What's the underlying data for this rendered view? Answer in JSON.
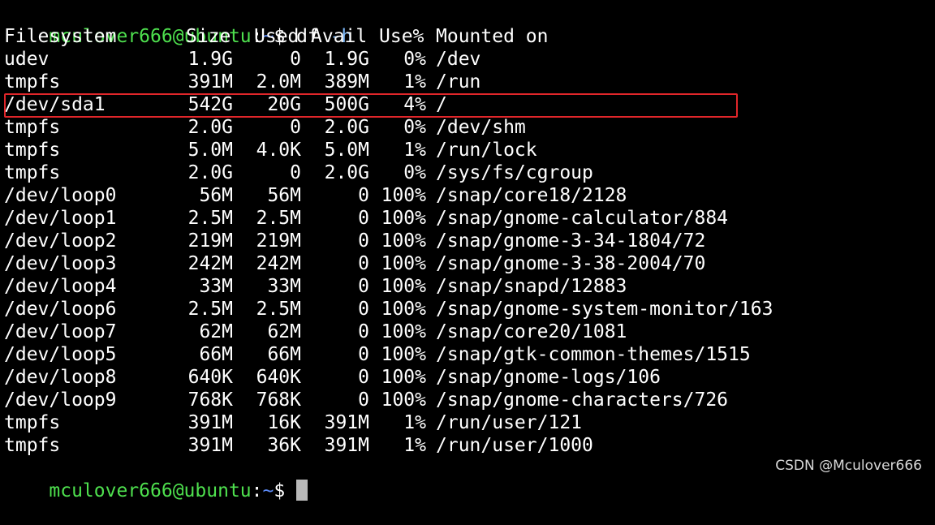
{
  "prompt": {
    "user_host": "mculover666@ubuntu",
    "separator": ":",
    "path": "~",
    "symbol": "$"
  },
  "command": {
    "name": "df",
    "flag": "-h"
  },
  "table": {
    "headers": [
      "Filesystem",
      "Size",
      "Used",
      "Avail",
      "Use%",
      "Mounted on"
    ],
    "rows": [
      [
        "udev",
        "1.9G",
        "0",
        "1.9G",
        "0%",
        "/dev"
      ],
      [
        "tmpfs",
        "391M",
        "2.0M",
        "389M",
        "1%",
        "/run"
      ],
      [
        "/dev/sda1",
        "542G",
        "20G",
        "500G",
        "4%",
        "/"
      ],
      [
        "tmpfs",
        "2.0G",
        "0",
        "2.0G",
        "0%",
        "/dev/shm"
      ],
      [
        "tmpfs",
        "5.0M",
        "4.0K",
        "5.0M",
        "1%",
        "/run/lock"
      ],
      [
        "tmpfs",
        "2.0G",
        "0",
        "2.0G",
        "0%",
        "/sys/fs/cgroup"
      ],
      [
        "/dev/loop0",
        "56M",
        "56M",
        "0",
        "100%",
        "/snap/core18/2128"
      ],
      [
        "/dev/loop1",
        "2.5M",
        "2.5M",
        "0",
        "100%",
        "/snap/gnome-calculator/884"
      ],
      [
        "/dev/loop2",
        "219M",
        "219M",
        "0",
        "100%",
        "/snap/gnome-3-34-1804/72"
      ],
      [
        "/dev/loop3",
        "242M",
        "242M",
        "0",
        "100%",
        "/snap/gnome-3-38-2004/70"
      ],
      [
        "/dev/loop4",
        "33M",
        "33M",
        "0",
        "100%",
        "/snap/snapd/12883"
      ],
      [
        "/dev/loop6",
        "2.5M",
        "2.5M",
        "0",
        "100%",
        "/snap/gnome-system-monitor/163"
      ],
      [
        "/dev/loop7",
        "62M",
        "62M",
        "0",
        "100%",
        "/snap/core20/1081"
      ],
      [
        "/dev/loop5",
        "66M",
        "66M",
        "0",
        "100%",
        "/snap/gtk-common-themes/1515"
      ],
      [
        "/dev/loop8",
        "640K",
        "640K",
        "0",
        "100%",
        "/snap/gnome-logs/106"
      ],
      [
        "/dev/loop9",
        "768K",
        "768K",
        "0",
        "100%",
        "/snap/gnome-characters/726"
      ],
      [
        "tmpfs",
        "391M",
        "16K",
        "391M",
        "1%",
        "/run/user/121"
      ],
      [
        "tmpfs",
        "391M",
        "36K",
        "391M",
        "1%",
        "/run/user/1000"
      ]
    ]
  },
  "watermark": "CSDN @Mculover666",
  "colors": {
    "background": "#000000",
    "prompt_user": "#4ee04e",
    "prompt_path": "#5b8af7",
    "highlight": "#e0262a",
    "cursor": "#b9b9b9"
  }
}
